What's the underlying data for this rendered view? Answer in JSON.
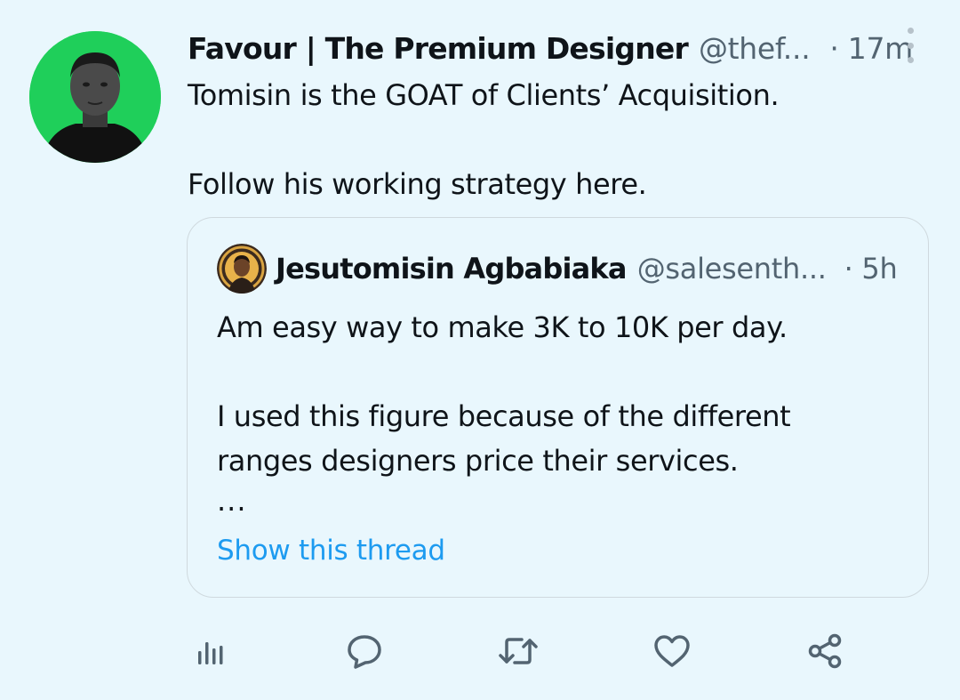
{
  "tweet": {
    "author": {
      "display_name": "Favour | The Premium Designer",
      "handle": "@thef...",
      "time": "· 17m"
    },
    "text_lines": [
      "Tomisin is the GOAT of Clients’ Acquisition.",
      "Follow his working strategy here."
    ],
    "quote": {
      "author": {
        "display_name": "Jesutomisin Agbabiaka",
        "handle": "@salesenth...",
        "time": "· 5h"
      },
      "text_lines": [
        "Am easy way to make 3K to 10K per day.",
        "I used this figure because of the different",
        "ranges designers price their services.",
        "..."
      ],
      "show_thread_label": "Show this thread"
    },
    "actions": [
      {
        "name": "analytics",
        "icon": "bar-chart-icon"
      },
      {
        "name": "reply",
        "icon": "comment-icon"
      },
      {
        "name": "retweet",
        "icon": "retweet-icon"
      },
      {
        "name": "like",
        "icon": "heart-icon"
      },
      {
        "name": "share",
        "icon": "share-icon"
      }
    ]
  },
  "colors": {
    "background": "#e9f7fd",
    "text": "#0f1419",
    "secondary_text": "#536471",
    "link": "#1d9bf0",
    "avatar_background": "#1fcf5a",
    "icon": "#536471"
  }
}
